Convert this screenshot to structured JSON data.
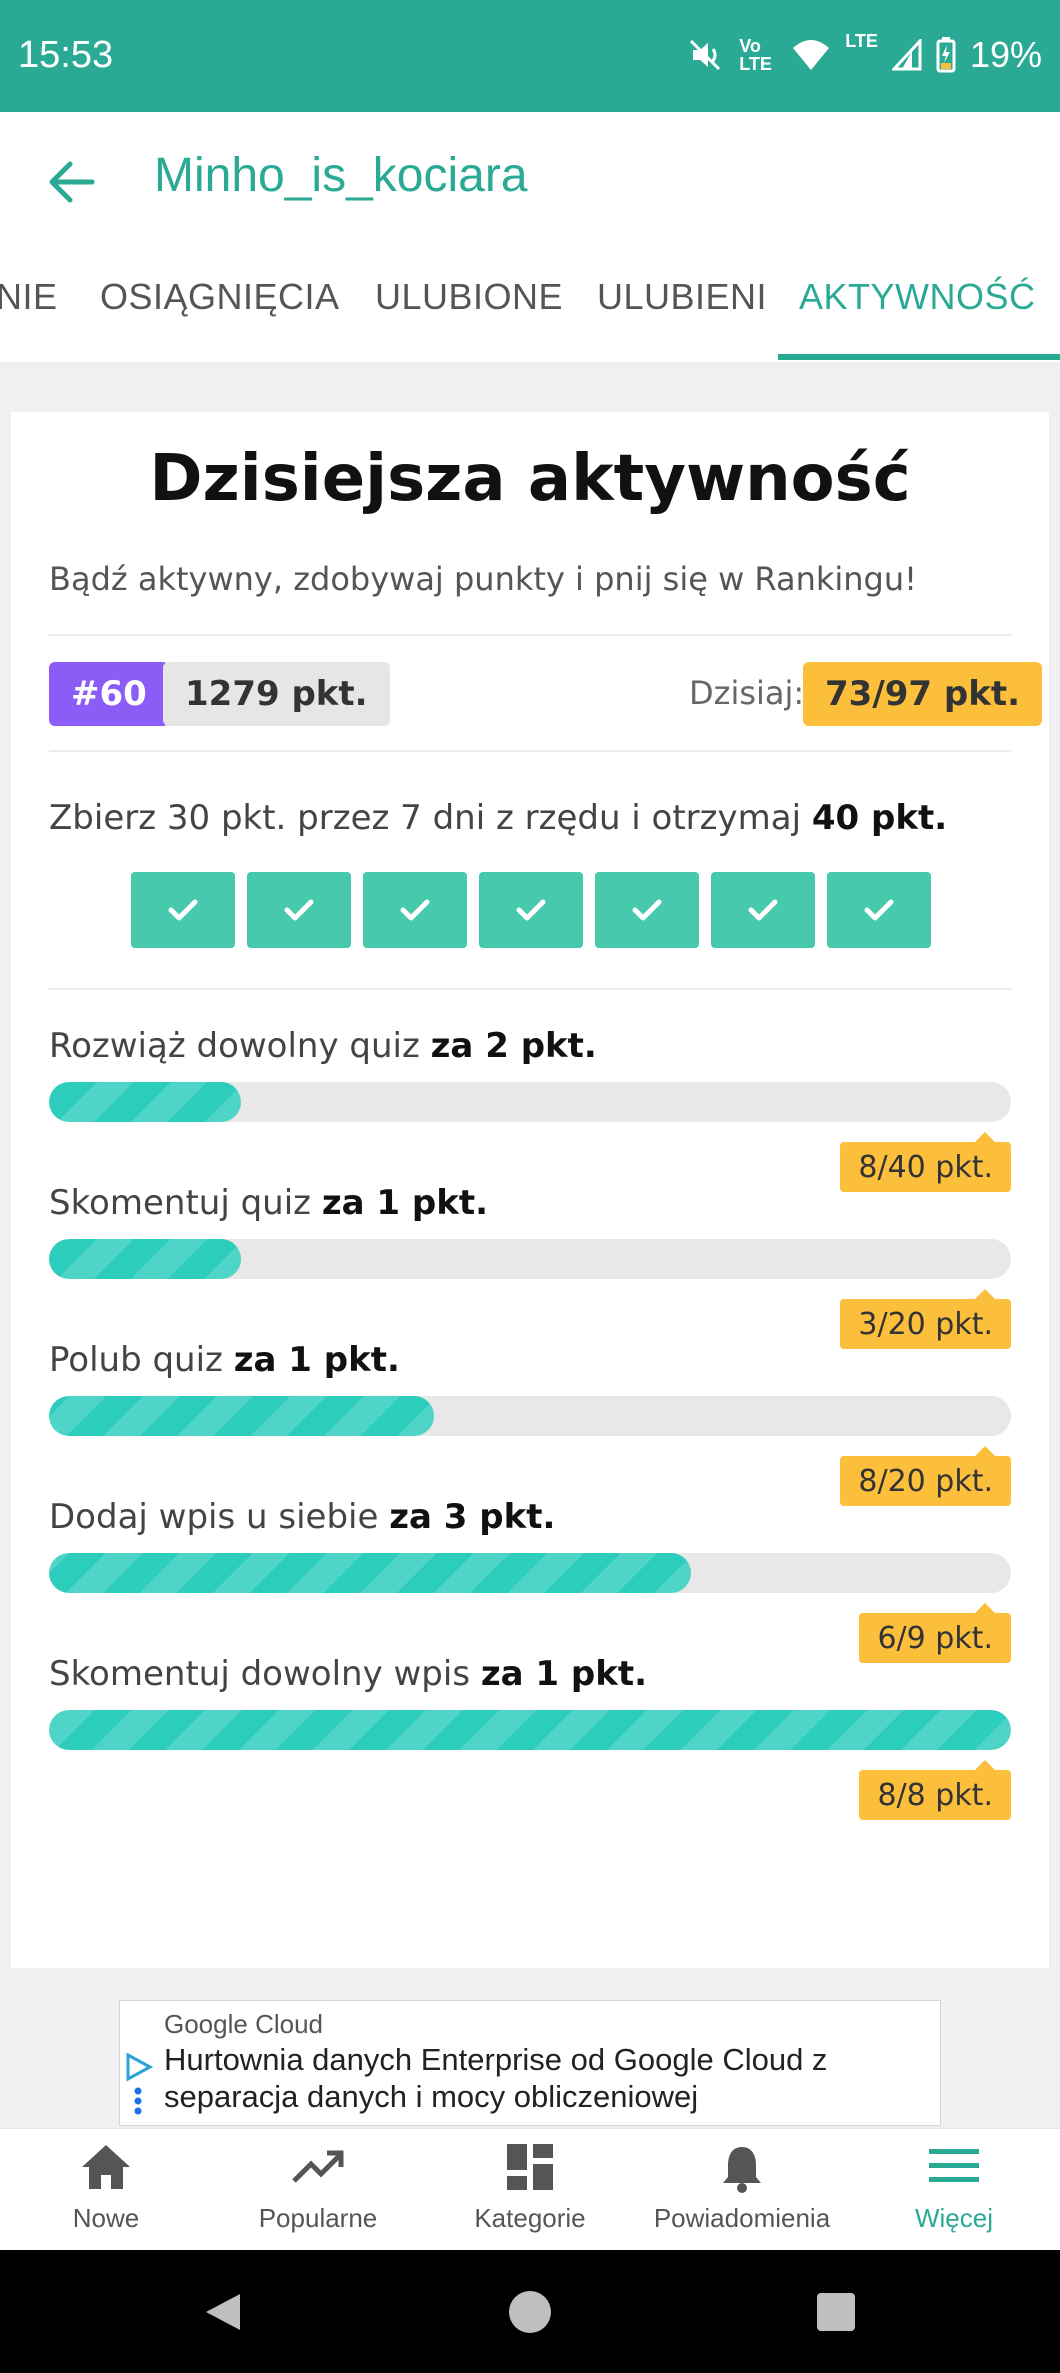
{
  "status_bar": {
    "time": "15:53",
    "battery": "19%",
    "network": "LTE",
    "volte": "Vo LTE"
  },
  "app_bar": {
    "title": "Minho_is_kociara",
    "back_icon": "arrow-left-icon"
  },
  "tabs": [
    {
      "label": "NIE"
    },
    {
      "label": "OSIĄGNIĘCIA"
    },
    {
      "label": "ULUBIONE"
    },
    {
      "label": "ULUBIENI"
    },
    {
      "label": "AKTYWNOŚĆ",
      "active": true
    }
  ],
  "activity": {
    "title": "Dzisiejsza aktywność",
    "subtitle": "Bądź aktywny, zdobywaj punkty i pnij się w Rankingu!",
    "rank": "#60",
    "points": "1279 pkt.",
    "today_label": "Dzisiaj:",
    "today_value": "73/97 pkt.",
    "streak_text": "Zbierz 30 pkt. przez 7 dni z rzędu i otrzymaj ",
    "streak_reward": "40 pkt.",
    "streak_days_completed": 7,
    "tasks": [
      {
        "label": "Rozwiąż dowolny quiz ",
        "reward": "za 2 pkt.",
        "progress": "8/40 pkt.",
        "fraction": 0.2
      },
      {
        "label": "Skomentuj quiz ",
        "reward": "za 1 pkt.",
        "progress": "3/20 pkt.",
        "fraction": 0.15
      },
      {
        "label": "Polub quiz ",
        "reward": "za 1 pkt.",
        "progress": "8/20 pkt.",
        "fraction": 0.4
      },
      {
        "label": "Dodaj wpis u siebie ",
        "reward": "za 3 pkt.",
        "progress": "6/9 pkt.",
        "fraction": 0.667
      },
      {
        "label": "Skomentuj dowolny wpis ",
        "reward": "za 1 pkt.",
        "progress": "8/8 pkt.",
        "fraction": 1.0
      }
    ]
  },
  "ad": {
    "advertiser": "Google Cloud",
    "headline": "Hurtownia danych Enterprise od Google Cloud z separacja danych i mocy obliczeniowej"
  },
  "bottom_nav": [
    {
      "label": "Nowe",
      "icon": "home-icon"
    },
    {
      "label": "Popularne",
      "icon": "trending-icon"
    },
    {
      "label": "Kategorie",
      "icon": "dashboard-icon"
    },
    {
      "label": "Powiadomienia",
      "icon": "bell-icon"
    },
    {
      "label": "Więcej",
      "icon": "menu-icon",
      "active": true
    }
  ],
  "colors": {
    "brand": "#2aaa94",
    "accent_purple": "#8b5cf6",
    "accent_yellow": "#fbbf3c",
    "progress": "#2ccdbd"
  }
}
